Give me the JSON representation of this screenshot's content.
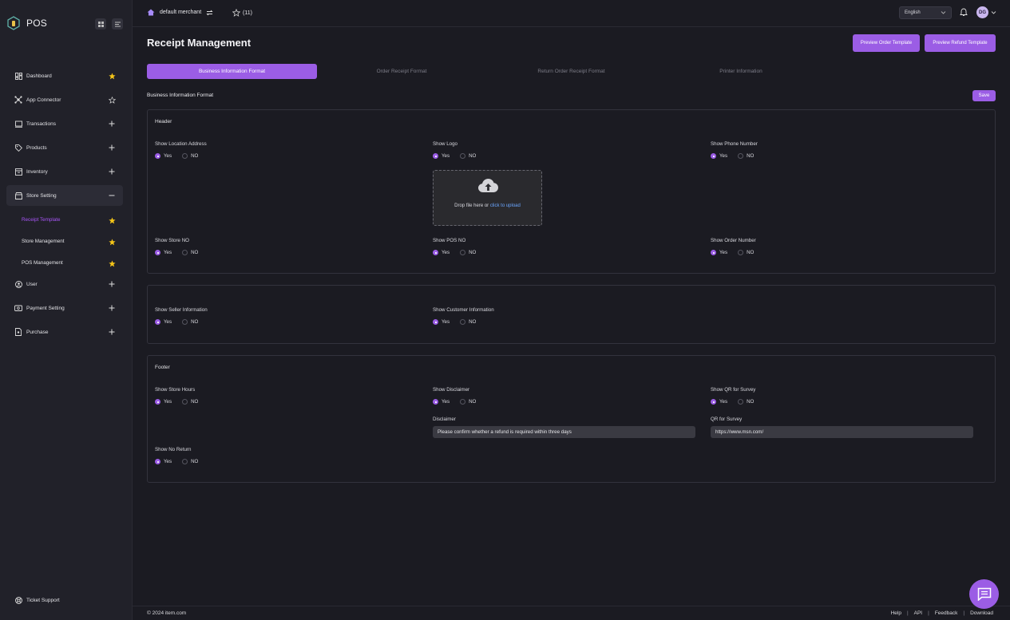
{
  "brand": {
    "name": "POS"
  },
  "sidebar": {
    "items": [
      {
        "label": "Dashboard",
        "icon": "dashboard-icon",
        "trail": "star-filled"
      },
      {
        "label": "App Connector",
        "icon": "app-connector-icon",
        "trail": "star-outline"
      },
      {
        "label": "Transactions",
        "icon": "transactions-icon",
        "trail": "plus"
      },
      {
        "label": "Products",
        "icon": "tag-icon",
        "trail": "plus"
      },
      {
        "label": "Inventory",
        "icon": "inventory-icon",
        "trail": "plus"
      },
      {
        "label": "Store Setting",
        "icon": "store-icon",
        "trail": "minus"
      }
    ],
    "sub_items": [
      {
        "label": "Receipt Template"
      },
      {
        "label": "Store Management"
      },
      {
        "label": "POS Management"
      }
    ],
    "items_after": [
      {
        "label": "User",
        "icon": "user-icon",
        "trail": "plus"
      },
      {
        "label": "Payment Setting",
        "icon": "payment-icon",
        "trail": "plus"
      },
      {
        "label": "Purchase",
        "icon": "purchase-icon",
        "trail": "plus"
      }
    ],
    "ticket_support": "Ticket Support"
  },
  "topbar": {
    "merchant": "default merchant",
    "favorites": "(11)",
    "language": "English",
    "avatar_initials": "DG"
  },
  "page": {
    "title": "Receipt Management",
    "preview_order": "Preview Order Template",
    "preview_refund": "Preview Refund Template",
    "tabs": [
      "Business Information Format",
      "Order Receipt Format",
      "Return Order Receipt Format",
      "Printer Information"
    ],
    "section_label": "Business Information Format",
    "save": "Save"
  },
  "header_card": {
    "title": "Header",
    "show_location_address": "Show Location Address",
    "show_logo": "Show Logo",
    "show_phone_number": "Show Phone Number",
    "upload_text": "Drop file here or ",
    "upload_link": "click to upload",
    "show_store_no": "Show Store NO",
    "show_pos_no": "Show POS NO",
    "show_order_number": "Show Order Number"
  },
  "middle_card": {
    "show_seller_info": "Show Seller Information",
    "show_customer_info": "Show Customer Information"
  },
  "footer_card": {
    "title": "Footer",
    "show_store_hours": "Show Store Hours",
    "show_disclaimer": "Show Disclaimer",
    "show_qr_survey": "Show QR for Survey",
    "disclaimer_label": "Disclaimer",
    "disclaimer_value": "Please confirm whether a refund is required within three days",
    "qr_label": "QR for Survey",
    "qr_value": "https://www.msn.com/",
    "show_no_return": "Show No Return"
  },
  "radio": {
    "yes": "Yes",
    "no": "NO"
  },
  "footer": {
    "copyright": "© 2024 item.com",
    "links": [
      "Help",
      "API",
      "Feedback",
      "Download"
    ]
  },
  "colors": {
    "accent": "#9b5de5",
    "star": "#f5c518",
    "link": "#6aa6ff"
  }
}
